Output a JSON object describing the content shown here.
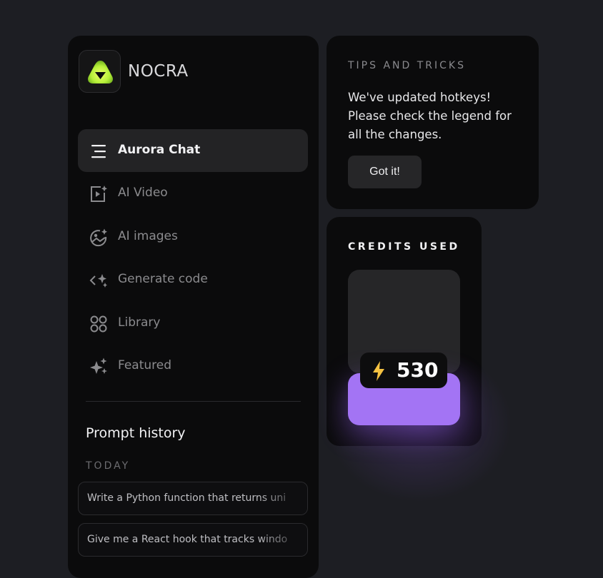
{
  "brand": {
    "name": "NOCRA"
  },
  "nav": {
    "items": [
      {
        "label": "Aurora Chat",
        "icon": "menu-lines-icon",
        "active": true
      },
      {
        "label": "AI Video",
        "icon": "video-sparkle-icon",
        "active": false
      },
      {
        "label": "AI images",
        "icon": "image-sparkle-icon",
        "active": false
      },
      {
        "label": "Generate code",
        "icon": "code-sparkle-icon",
        "active": false
      },
      {
        "label": "Library",
        "icon": "grid-circles-icon",
        "active": false
      },
      {
        "label": "Featured",
        "icon": "sparkles-icon",
        "active": false
      }
    ]
  },
  "prompt_history": {
    "title": "Prompt history",
    "group_label": "TODAY",
    "items": [
      "Write a Python function that returns uni",
      "Give me a React hook that tracks windo"
    ]
  },
  "tips": {
    "title": "TIPS AND TRICKS",
    "body": "We've updated hotkeys! Please check the legend for all the changes.",
    "button_label": "Got it!"
  },
  "credits": {
    "title": "CREDITS USED",
    "value": "530",
    "accent": "#a374f4",
    "bolt_color": "#f5c242"
  }
}
